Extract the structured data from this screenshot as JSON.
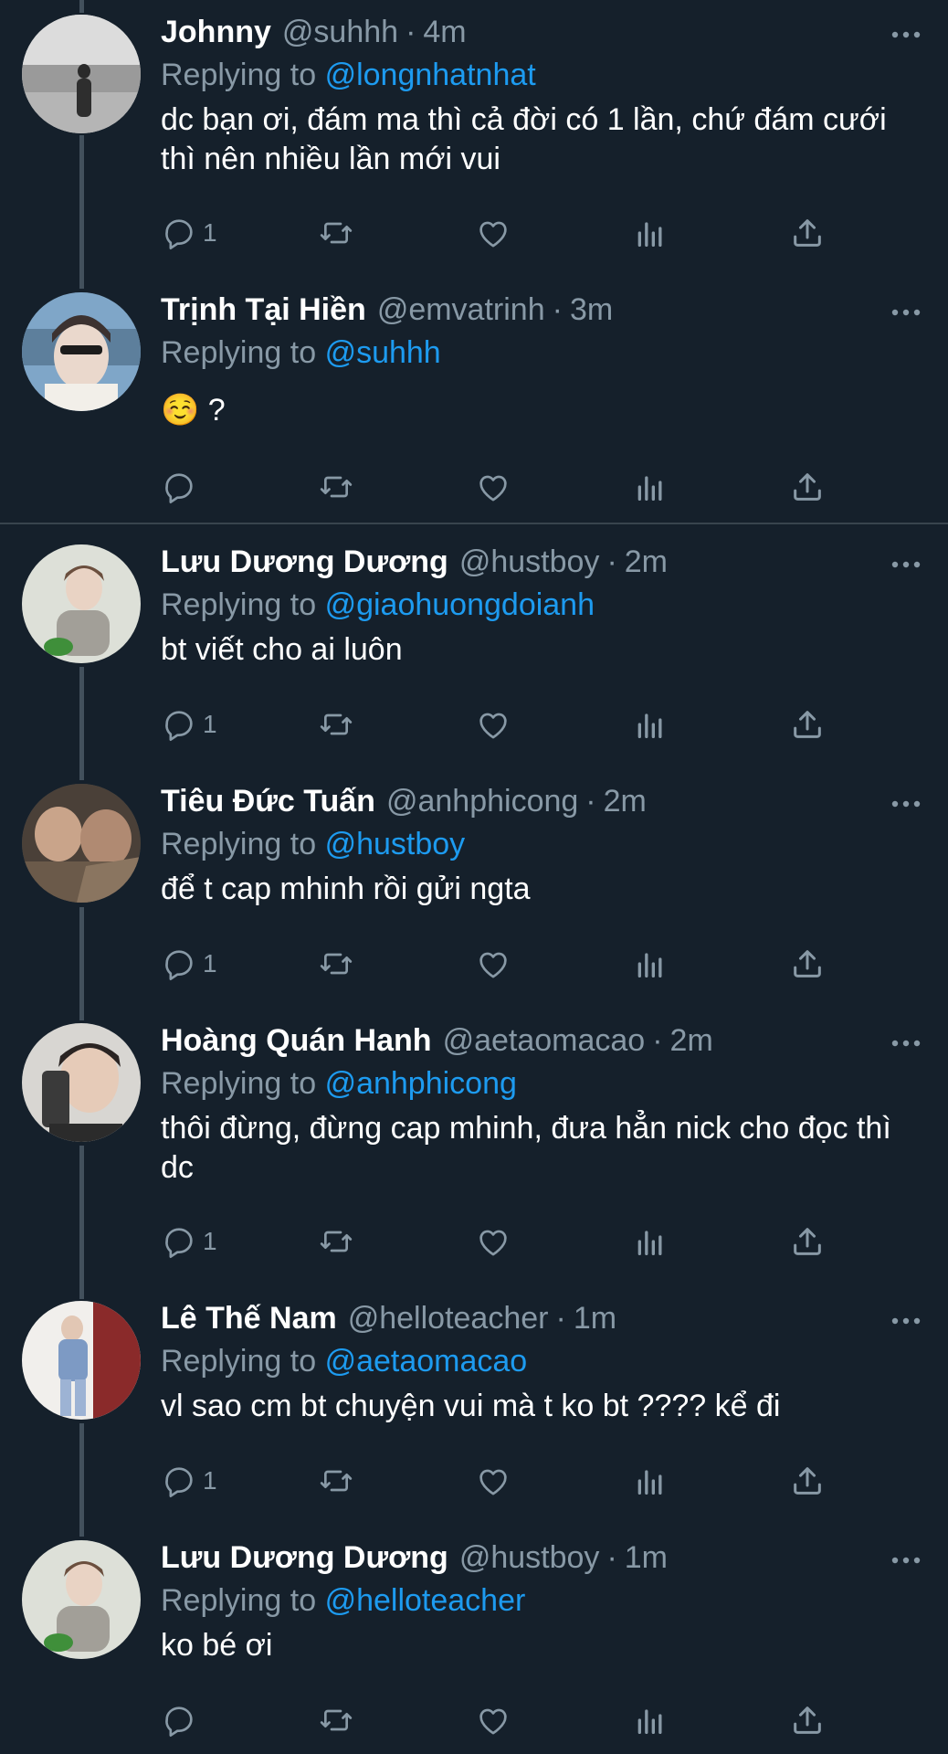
{
  "colors": {
    "background": "#15202b",
    "mention": "#1d9bf0",
    "muted": "#8899a6",
    "text": "#ffffff"
  },
  "icons": {
    "reply": "reply-icon",
    "retweet": "retweet-icon",
    "like": "heart-icon",
    "views": "views-icon",
    "share": "share-icon",
    "more": "more-icon"
  },
  "tweets": [
    {
      "name": "Johnny",
      "handle": "@suhhh",
      "sep": "·",
      "time": "4m",
      "replying_prefix": "Replying to",
      "replying_to": "@longnhatnhat",
      "text": "dc bạn ơi, đám ma thì cả đời có 1 lần, chứ đám cưới thì nên nhiều lần mới vui",
      "reply_count": "1"
    },
    {
      "name": "Trịnh Tại Hiền",
      "handle": "@emvatrinh",
      "sep": "·",
      "time": "3m",
      "replying_prefix": "Replying to",
      "replying_to": "@suhhh",
      "text": "☺️ ?",
      "reply_count": ""
    },
    {
      "name": "Lưu Dương Dương",
      "handle": "@hustboy",
      "sep": "·",
      "time": "2m",
      "replying_prefix": "Replying to",
      "replying_to": "@giaohuongdoianh",
      "text": "bt viết cho ai luôn",
      "reply_count": "1"
    },
    {
      "name": "Tiêu Đức Tuấn",
      "handle": "@anhphicong",
      "sep": "·",
      "time": "2m",
      "replying_prefix": "Replying to",
      "replying_to": "@hustboy",
      "text": "để t cap mhinh rồi gửi ngta",
      "reply_count": "1"
    },
    {
      "name": "Hoàng Quán Hanh",
      "handle": "@aetaomacao",
      "sep": "·",
      "time": "2m",
      "replying_prefix": "Replying to",
      "replying_to": "@anhphicong",
      "text": "thôi đừng, đừng cap mhinh, đưa hẳn nick cho đọc thì dc",
      "reply_count": "1"
    },
    {
      "name": "Lê Thế Nam",
      "handle": "@helloteacher",
      "sep": "·",
      "time": "1m",
      "replying_prefix": "Replying to",
      "replying_to": "@aetaomacao",
      "text": "vl sao cm bt chuyện vui mà t ko bt ???? kể đi",
      "reply_count": "1"
    },
    {
      "name": "Lưu Dương Dương",
      "handle": "@hustboy",
      "sep": "·",
      "time": "1m",
      "replying_prefix": "Replying to",
      "replying_to": "@helloteacher",
      "text": "ko bé ơi",
      "reply_count": ""
    }
  ]
}
